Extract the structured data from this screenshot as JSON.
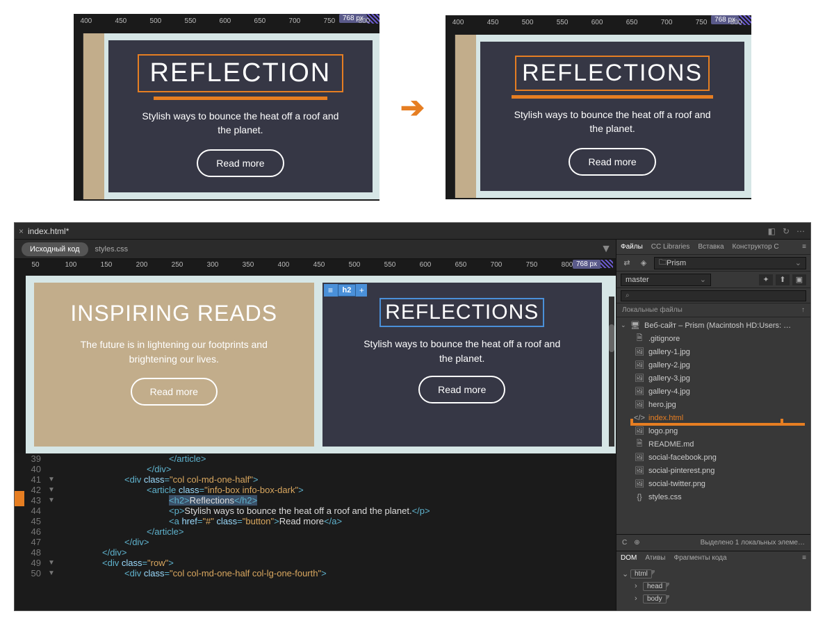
{
  "ruler": {
    "badge": "768 px",
    "marks": [
      400,
      450,
      500,
      550,
      600,
      650,
      700,
      750,
      800
    ]
  },
  "preview_left": {
    "title": "REFLECTION",
    "blurb": "Stylish ways to bounce the heat off a roof and the planet.",
    "button": "Read more"
  },
  "preview_right": {
    "title": "REFLECTIONS",
    "blurb": "Stylish ways to bounce the heat off a roof and the planet.",
    "button": "Read more"
  },
  "app": {
    "tab": {
      "close": "×",
      "name": "index.html*"
    },
    "subtabs": {
      "active": "Исходный код",
      "other": "styles.css"
    },
    "live_ruler": {
      "badge": "768 px",
      "marks": [
        50,
        100,
        150,
        200,
        250,
        300,
        350,
        400,
        450,
        500,
        550,
        600,
        650,
        700,
        750,
        800
      ]
    },
    "card_tan": {
      "title": "INSPIRING READS",
      "blurb": "The future is in lightening our footprints and brightening our lives.",
      "button": "Read more"
    },
    "card_dark": {
      "badge_tag": "h2",
      "title": "REFLECTIONS",
      "blurb": "Stylish ways to bounce the heat off a roof and the planet.",
      "button": "Read more"
    },
    "code": {
      "lines": [
        {
          "n": 39,
          "arrow": "",
          "indent": 20,
          "tokens": [
            [
              "tag",
              "</article>"
            ]
          ]
        },
        {
          "n": 40,
          "arrow": "",
          "indent": 16,
          "tokens": [
            [
              "tag",
              "</div>"
            ]
          ]
        },
        {
          "n": 41,
          "arrow": "▼",
          "indent": 12,
          "tokens": [
            [
              "tag",
              "<div "
            ],
            [
              "attr",
              "class"
            ],
            [
              "tag",
              "="
            ],
            [
              "str",
              "\"col col-md-one-half\""
            ],
            [
              "tag",
              ">"
            ]
          ]
        },
        {
          "n": 42,
          "arrow": "▼",
          "indent": 16,
          "tokens": [
            [
              "tag",
              "<article "
            ],
            [
              "attr",
              "class"
            ],
            [
              "tag",
              "="
            ],
            [
              "str",
              "\"info-box info-box-dark\""
            ],
            [
              "tag",
              ">"
            ]
          ]
        },
        {
          "n": 43,
          "arrow": "▼",
          "indent": 20,
          "hl": true,
          "tokens": [
            [
              "tag",
              "<h2>"
            ],
            [
              "txt",
              "Reflections"
            ],
            [
              "tag",
              "</h2>"
            ]
          ]
        },
        {
          "n": 44,
          "arrow": "",
          "indent": 20,
          "tokens": [
            [
              "tag",
              "<p>"
            ],
            [
              "txt",
              "Stylish ways to bounce the heat off a roof and the planet."
            ],
            [
              "tag",
              "</p>"
            ]
          ]
        },
        {
          "n": 45,
          "arrow": "",
          "indent": 20,
          "tokens": [
            [
              "tag",
              "<a "
            ],
            [
              "attr",
              "href"
            ],
            [
              "tag",
              "="
            ],
            [
              "str",
              "\"#\""
            ],
            [
              "tag",
              " "
            ],
            [
              "attr",
              "class"
            ],
            [
              "tag",
              "="
            ],
            [
              "str",
              "\"button\""
            ],
            [
              "tag",
              ">"
            ],
            [
              "txt",
              "Read more"
            ],
            [
              "tag",
              "</a>"
            ]
          ]
        },
        {
          "n": 46,
          "arrow": "",
          "indent": 16,
          "tokens": [
            [
              "tag",
              "</article>"
            ]
          ]
        },
        {
          "n": 47,
          "arrow": "",
          "indent": 12,
          "tokens": [
            [
              "tag",
              "</div>"
            ]
          ]
        },
        {
          "n": 48,
          "arrow": "",
          "indent": 8,
          "tokens": [
            [
              "tag",
              "</div>"
            ]
          ]
        },
        {
          "n": 49,
          "arrow": "▼",
          "indent": 8,
          "tokens": [
            [
              "tag",
              "<div "
            ],
            [
              "attr",
              "class"
            ],
            [
              "tag",
              "="
            ],
            [
              "str",
              "\"row\""
            ],
            [
              "tag",
              ">"
            ]
          ]
        },
        {
          "n": 50,
          "arrow": "▼",
          "indent": 12,
          "tokens": [
            [
              "tag",
              "<div "
            ],
            [
              "attr",
              "class"
            ],
            [
              "tag",
              "="
            ],
            [
              "str",
              "\"col col-md-one-half col-lg-one-fourth\""
            ],
            [
              "tag",
              ">"
            ]
          ]
        }
      ]
    }
  },
  "panel": {
    "tabs": [
      "Файлы",
      "CC Libraries",
      "Вставка",
      "Конструктор C"
    ],
    "folder": "Prism",
    "branch": "master",
    "search_placeholder": "⌕",
    "header": "Локальные файлы",
    "root": "Веб-сайт – Prism (Macintosh HD:Users: …",
    "files": [
      {
        "icon": "doc",
        "name": ".gitignore"
      },
      {
        "icon": "img",
        "name": "gallery-1.jpg"
      },
      {
        "icon": "img",
        "name": "gallery-2.jpg"
      },
      {
        "icon": "img",
        "name": "gallery-3.jpg"
      },
      {
        "icon": "img",
        "name": "gallery-4.jpg"
      },
      {
        "icon": "img",
        "name": "hero.jpg"
      },
      {
        "icon": "code",
        "name": "index.html",
        "hl": true
      },
      {
        "icon": "img",
        "name": "logo.png"
      },
      {
        "icon": "doc",
        "name": "README.md"
      },
      {
        "icon": "img",
        "name": "social-facebook.png"
      },
      {
        "icon": "img",
        "name": "social-pinterest.png"
      },
      {
        "icon": "img",
        "name": "social-twitter.png"
      },
      {
        "icon": "css",
        "name": "styles.css"
      }
    ],
    "status": "Выделено 1 локальных элеме…",
    "dom_tabs": [
      "DOM",
      "Ативы",
      "Фрагменты кода"
    ],
    "dom": [
      "html",
      "head",
      "body"
    ]
  }
}
